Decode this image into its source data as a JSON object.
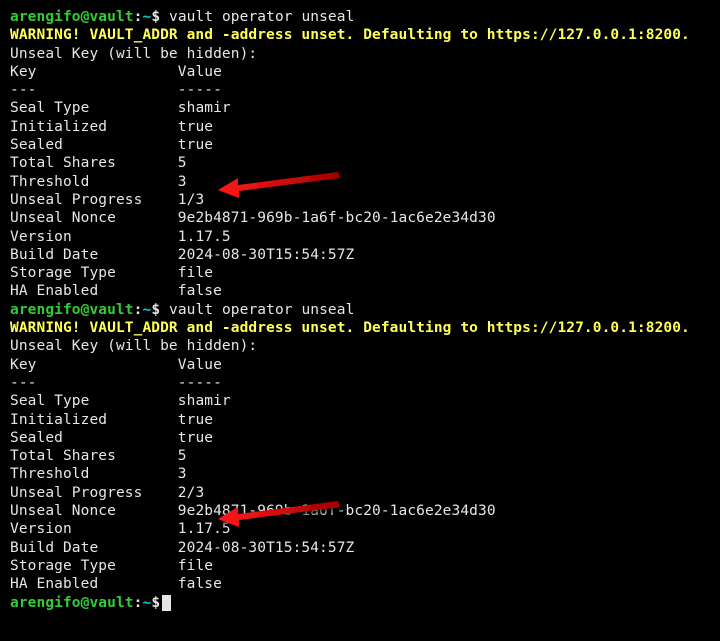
{
  "prompt": {
    "user": "arengifo@vault",
    "sep": ":",
    "path": "~",
    "sym": "$"
  },
  "cmd": "vault operator unseal",
  "warn": "WARNING! VAULT_ADDR and -address unset. Defaulting to https://127.0.0.1:8200.",
  "hidden": "Unseal Key (will be hidden):",
  "hdr": {
    "k": "Key",
    "v": "Value",
    "ku": "---",
    "vu": "-----"
  },
  "b1": {
    "seal_type_k": "Seal Type",
    "seal_type_v": "shamir",
    "init_k": "Initialized",
    "init_v": "true",
    "sealed_k": "Sealed",
    "sealed_v": "true",
    "shares_k": "Total Shares",
    "shares_v": "5",
    "thresh_k": "Threshold",
    "thresh_v": "3",
    "prog_k": "Unseal Progress",
    "prog_v": "1/3",
    "nonce_k": "Unseal Nonce",
    "nonce_v": "9e2b4871-969b-1a6f-bc20-1ac6e2e34d30",
    "ver_k": "Version",
    "ver_v": "1.17.5",
    "build_k": "Build Date",
    "build_v": "2024-08-30T15:54:57Z",
    "stor_k": "Storage Type",
    "stor_v": "file",
    "ha_k": "HA Enabled",
    "ha_v": "false"
  },
  "b2": {
    "seal_type_k": "Seal Type",
    "seal_type_v": "shamir",
    "init_k": "Initialized",
    "init_v": "true",
    "sealed_k": "Sealed",
    "sealed_v": "true",
    "shares_k": "Total Shares",
    "shares_v": "5",
    "thresh_k": "Threshold",
    "thresh_v": "3",
    "prog_k": "Unseal Progress",
    "prog_v": "2/3",
    "nonce_k": "Unseal Nonce",
    "nonce_v": "9e2b4871-969b-1a6f-bc20-1ac6e2e34d30",
    "ver_k": "Version",
    "ver_v": "1.17.5",
    "build_k": "Build Date",
    "build_v": "2024-08-30T15:54:57Z",
    "stor_k": "Storage Type",
    "stor_v": "file",
    "ha_k": "HA Enabled",
    "ha_v": "false"
  }
}
